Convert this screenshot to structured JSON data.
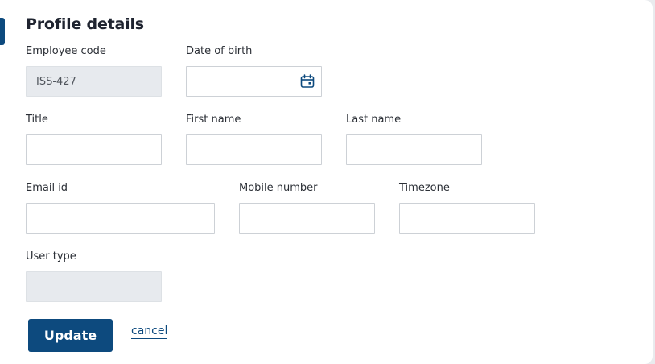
{
  "section": {
    "title": "Profile details"
  },
  "fields": {
    "employee_code": {
      "label": "Employee code",
      "value": "ISS-427"
    },
    "date_of_birth": {
      "label": "Date of birth",
      "value": ""
    },
    "title": {
      "label": "Title",
      "value": ""
    },
    "first_name": {
      "label": "First name",
      "value": ""
    },
    "last_name": {
      "label": "Last name",
      "value": ""
    },
    "email_id": {
      "label": "Email id",
      "value": ""
    },
    "mobile_number": {
      "label": "Mobile number",
      "value": ""
    },
    "timezone": {
      "label": "Timezone",
      "value": ""
    },
    "user_type": {
      "label": "User type",
      "value": ""
    }
  },
  "actions": {
    "update_label": "Update",
    "cancel_label": "cancel"
  },
  "icons": {
    "date_picker": "calendar-icon"
  },
  "colors": {
    "primary": "#0d4a7e",
    "readonly_bg": "#e7eaee",
    "border": "#cdd1d6",
    "text": "#1f2430"
  }
}
